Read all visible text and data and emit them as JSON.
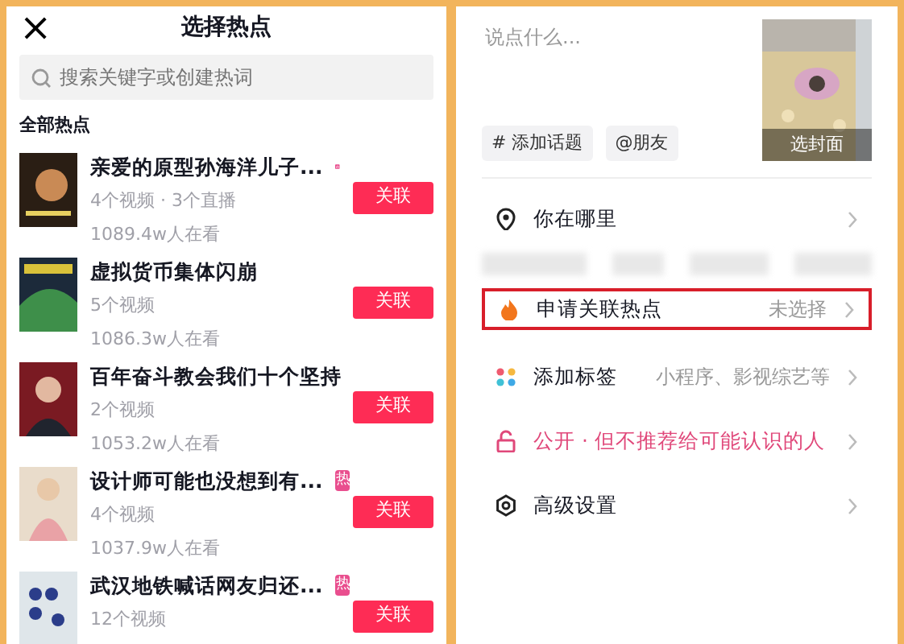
{
  "left": {
    "title": "选择热点",
    "close": "×",
    "search": {
      "placeholder": "搜索关键字或创建热词"
    },
    "section": "全部热点",
    "items": [
      {
        "kind": "chart_badge",
        "title": "亲爱的原型孙海洋儿子...",
        "meta": "4个视频 · 3个直播",
        "viewers": "1089.4w人在看",
        "button": "关联"
      },
      {
        "kind": "plain",
        "title": "虚拟货币集体闪崩",
        "meta": "5个视频",
        "viewers": "1086.3w人在看",
        "button": "关联"
      },
      {
        "kind": "plain",
        "title": "百年奋斗教会我们十个坚持",
        "meta": "2个视频",
        "viewers": "1053.2w人在看",
        "button": "关联"
      },
      {
        "kind": "hot_badge",
        "title": "设计师可能也没想到有...",
        "badge_text": "热",
        "meta": "4个视频",
        "viewers": "1037.9w人在看",
        "button": "关联"
      },
      {
        "kind": "hot_badge",
        "title": "武汉地铁喊话网友归还...",
        "badge_text": "热",
        "meta": "12个视频",
        "button": "关联"
      }
    ]
  },
  "right": {
    "caption": {
      "placeholder": "说点什么..."
    },
    "cover_label": "选封面",
    "chips": [
      "# 添加话题",
      "@朋友"
    ],
    "rows": [
      {
        "kind": "location",
        "label": "你在哪里",
        "highlighted": false
      },
      {
        "kind": "hotspot",
        "label": "申请关联热点",
        "value": "未选择",
        "highlighted": true
      },
      {
        "kind": "tags",
        "label": "添加标签",
        "value": "小程序、影视综艺等",
        "highlighted": false
      },
      {
        "kind": "privacy",
        "label": "公开 · 但不推荐给可能认识的人",
        "highlighted": false
      },
      {
        "kind": "settings",
        "label": "高级设置",
        "highlighted": false
      }
    ]
  }
}
